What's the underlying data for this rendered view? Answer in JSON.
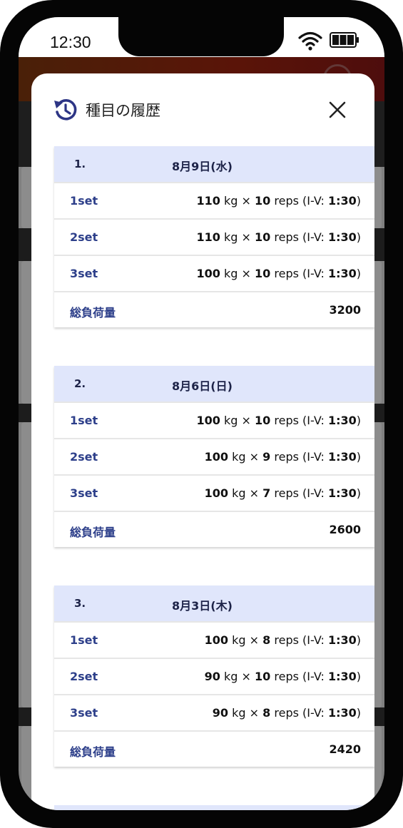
{
  "status_bar": {
    "time": "12:30"
  },
  "modal": {
    "title": "種目の履歴",
    "sessions": [
      {
        "number": "1.",
        "date": "8月9日(水)",
        "sets": [
          {
            "label": "1set",
            "weight": "110",
            "reps": "10",
            "interval": "1:30"
          },
          {
            "label": "2set",
            "weight": "110",
            "reps": "10",
            "interval": "1:30"
          },
          {
            "label": "3set",
            "weight": "100",
            "reps": "10",
            "interval": "1:30"
          }
        ],
        "total_label": "総負荷量",
        "total_value": "3200"
      },
      {
        "number": "2.",
        "date": "8月6日(日)",
        "sets": [
          {
            "label": "1set",
            "weight": "100",
            "reps": "10",
            "interval": "1:30"
          },
          {
            "label": "2set",
            "weight": "100",
            "reps": "9",
            "interval": "1:30"
          },
          {
            "label": "3set",
            "weight": "100",
            "reps": "7",
            "interval": "1:30"
          }
        ],
        "total_label": "総負荷量",
        "total_value": "2600"
      },
      {
        "number": "3.",
        "date": "8月3日(木)",
        "sets": [
          {
            "label": "1set",
            "weight": "100",
            "reps": "8",
            "interval": "1:30"
          },
          {
            "label": "2set",
            "weight": "90",
            "reps": "10",
            "interval": "1:30"
          },
          {
            "label": "3set",
            "weight": "90",
            "reps": "8",
            "interval": "1:30"
          }
        ],
        "total_label": "総負荷量",
        "total_value": "2420"
      }
    ]
  },
  "units": {
    "weight": "kg",
    "times": "×",
    "reps": "reps",
    "interval_prefix": "(I-V: ",
    "interval_suffix": ")"
  },
  "icons": {
    "history": "history-icon",
    "close": "close-icon",
    "wifi": "wifi-icon",
    "battery": "battery-icon"
  },
  "colors": {
    "accent_text": "#2d3f8a",
    "session_header_bg": "#e0e6fb",
    "app_header": "#5a1408"
  }
}
